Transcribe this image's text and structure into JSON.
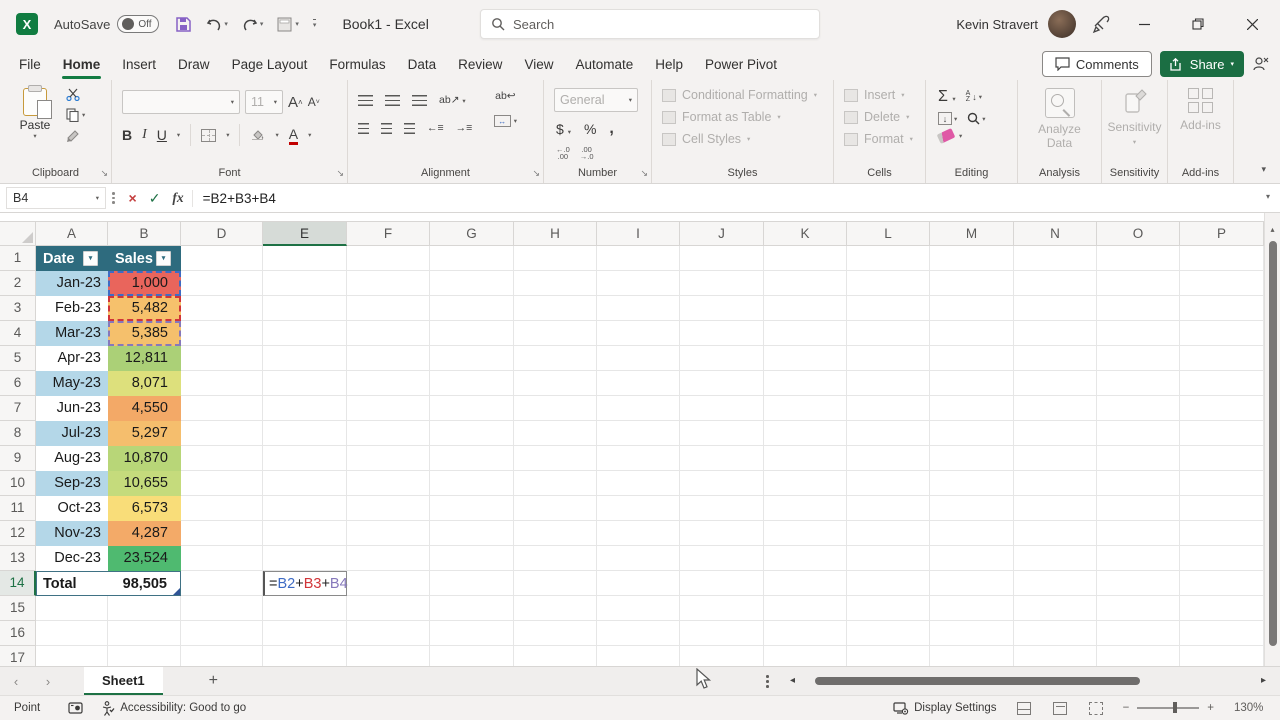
{
  "titlebar": {
    "autosave_label": "AutoSave",
    "autosave_state": "Off",
    "doc_title": "Book1  -  Excel",
    "search_placeholder": "Search",
    "user_name": "Kevin Stravert"
  },
  "tabs": [
    {
      "label": "File"
    },
    {
      "label": "Home"
    },
    {
      "label": "Insert"
    },
    {
      "label": "Draw"
    },
    {
      "label": "Page Layout"
    },
    {
      "label": "Formulas"
    },
    {
      "label": "Data"
    },
    {
      "label": "Review"
    },
    {
      "label": "View"
    },
    {
      "label": "Automate"
    },
    {
      "label": "Help"
    },
    {
      "label": "Power Pivot"
    }
  ],
  "actions": {
    "comments": "Comments",
    "share": "Share"
  },
  "ribbon": {
    "clipboard": {
      "label": "Clipboard",
      "paste": "Paste"
    },
    "font": {
      "label": "Font",
      "size": "11",
      "bold": "B",
      "italic": "I",
      "underline": "U",
      "grow": "A",
      "shrink": "A",
      "color": "A"
    },
    "alignment": {
      "label": "Alignment",
      "orient": "ab",
      "wrap": "ab"
    },
    "number": {
      "label": "Number",
      "format": "General",
      "currency": "$",
      "percent": "%",
      "comma": ",",
      "dec1": "←.0",
      "dec1b": ".00",
      "dec2": ".00",
      "dec2b": "→.0"
    },
    "styles": {
      "label": "Styles",
      "conditional": "Conditional Formatting",
      "format_table": "Format as Table",
      "cell_styles": "Cell Styles"
    },
    "cells": {
      "label": "Cells",
      "insert": "Insert",
      "delete": "Delete",
      "format": "Format"
    },
    "editing": {
      "label": "Editing",
      "autosum": "Σ",
      "sort_a": "A",
      "sort_z": "Z"
    },
    "analysis": {
      "label": "Analysis",
      "button": "Analyze Data"
    },
    "sensitivity": {
      "label": "Sensitivity",
      "button": "Sensitivity"
    },
    "addins": {
      "label": "Add-ins",
      "button": "Add-ins"
    }
  },
  "formula_bar": {
    "name_box": "B4",
    "formula": "=B2+B3+B4",
    "fx_label": "fx"
  },
  "grid": {
    "columns": [
      "A",
      "B",
      "D",
      "E",
      "F",
      "G",
      "H",
      "I",
      "J",
      "K",
      "L",
      "M",
      "N",
      "O",
      "P"
    ],
    "selected_column": "E",
    "row_count": 17,
    "active_row": 14,
    "table": {
      "header": {
        "date": "Date",
        "sales": "Sales"
      },
      "header_bg": "#2e6b7e",
      "band_color": "#b4d7e8",
      "rows": [
        {
          "row": 2,
          "date": "Jan-23",
          "sales": "1,000",
          "banded": true,
          "sales_bg": "#e9655c",
          "ref_border": "#3e6bc4"
        },
        {
          "row": 3,
          "date": "Feb-23",
          "sales": "5,482",
          "banded": false,
          "sales_bg": "#f6c16c",
          "ref_border": "#d13438"
        },
        {
          "row": 4,
          "date": "Mar-23",
          "sales": "5,385",
          "banded": true,
          "sales_bg": "#f5c06c",
          "ref_border": "#8678bb"
        },
        {
          "row": 5,
          "date": "Apr-23",
          "sales": "12,811",
          "banded": false,
          "sales_bg": "#abd077",
          "ref_border": null
        },
        {
          "row": 6,
          "date": "May-23",
          "sales": "8,071",
          "banded": true,
          "sales_bg": "#dde07c",
          "ref_border": null
        },
        {
          "row": 7,
          "date": "Jun-23",
          "sales": "4,550",
          "banded": false,
          "sales_bg": "#f3a967",
          "ref_border": null
        },
        {
          "row": 8,
          "date": "Jul-23",
          "sales": "5,297",
          "banded": true,
          "sales_bg": "#f5be6d",
          "ref_border": null
        },
        {
          "row": 9,
          "date": "Aug-23",
          "sales": "10,870",
          "banded": false,
          "sales_bg": "#b8d678",
          "ref_border": null
        },
        {
          "row": 10,
          "date": "Sep-23",
          "sales": "10,655",
          "banded": true,
          "sales_bg": "#c5db7c",
          "ref_border": null
        },
        {
          "row": 11,
          "date": "Oct-23",
          "sales": "6,573",
          "banded": false,
          "sales_bg": "#f9dd79",
          "ref_border": null
        },
        {
          "row": 12,
          "date": "Nov-23",
          "sales": "4,287",
          "banded": true,
          "sales_bg": "#f3aa68",
          "ref_border": null
        },
        {
          "row": 13,
          "date": "Dec-23",
          "sales": "23,524",
          "banded": false,
          "sales_bg": "#4fba70",
          "ref_border": null
        }
      ],
      "total": {
        "label": "Total",
        "value": "98,505"
      }
    },
    "edit_cell": {
      "address": "E14",
      "parts": [
        {
          "t": "=",
          "c": "#222222"
        },
        {
          "t": "B2",
          "c": "#3e6bc4"
        },
        {
          "t": "+",
          "c": "#222222"
        },
        {
          "t": "B3",
          "c": "#d13438"
        },
        {
          "t": "+",
          "c": "#222222"
        },
        {
          "t": "B4",
          "c": "#8678bb"
        }
      ]
    }
  },
  "sheet_bar": {
    "active_tab": "Sheet1"
  },
  "status_bar": {
    "mode": "Point",
    "accessibility": "Accessibility: Good to go",
    "display_settings": "Display Settings",
    "zoom_level": "130%"
  }
}
